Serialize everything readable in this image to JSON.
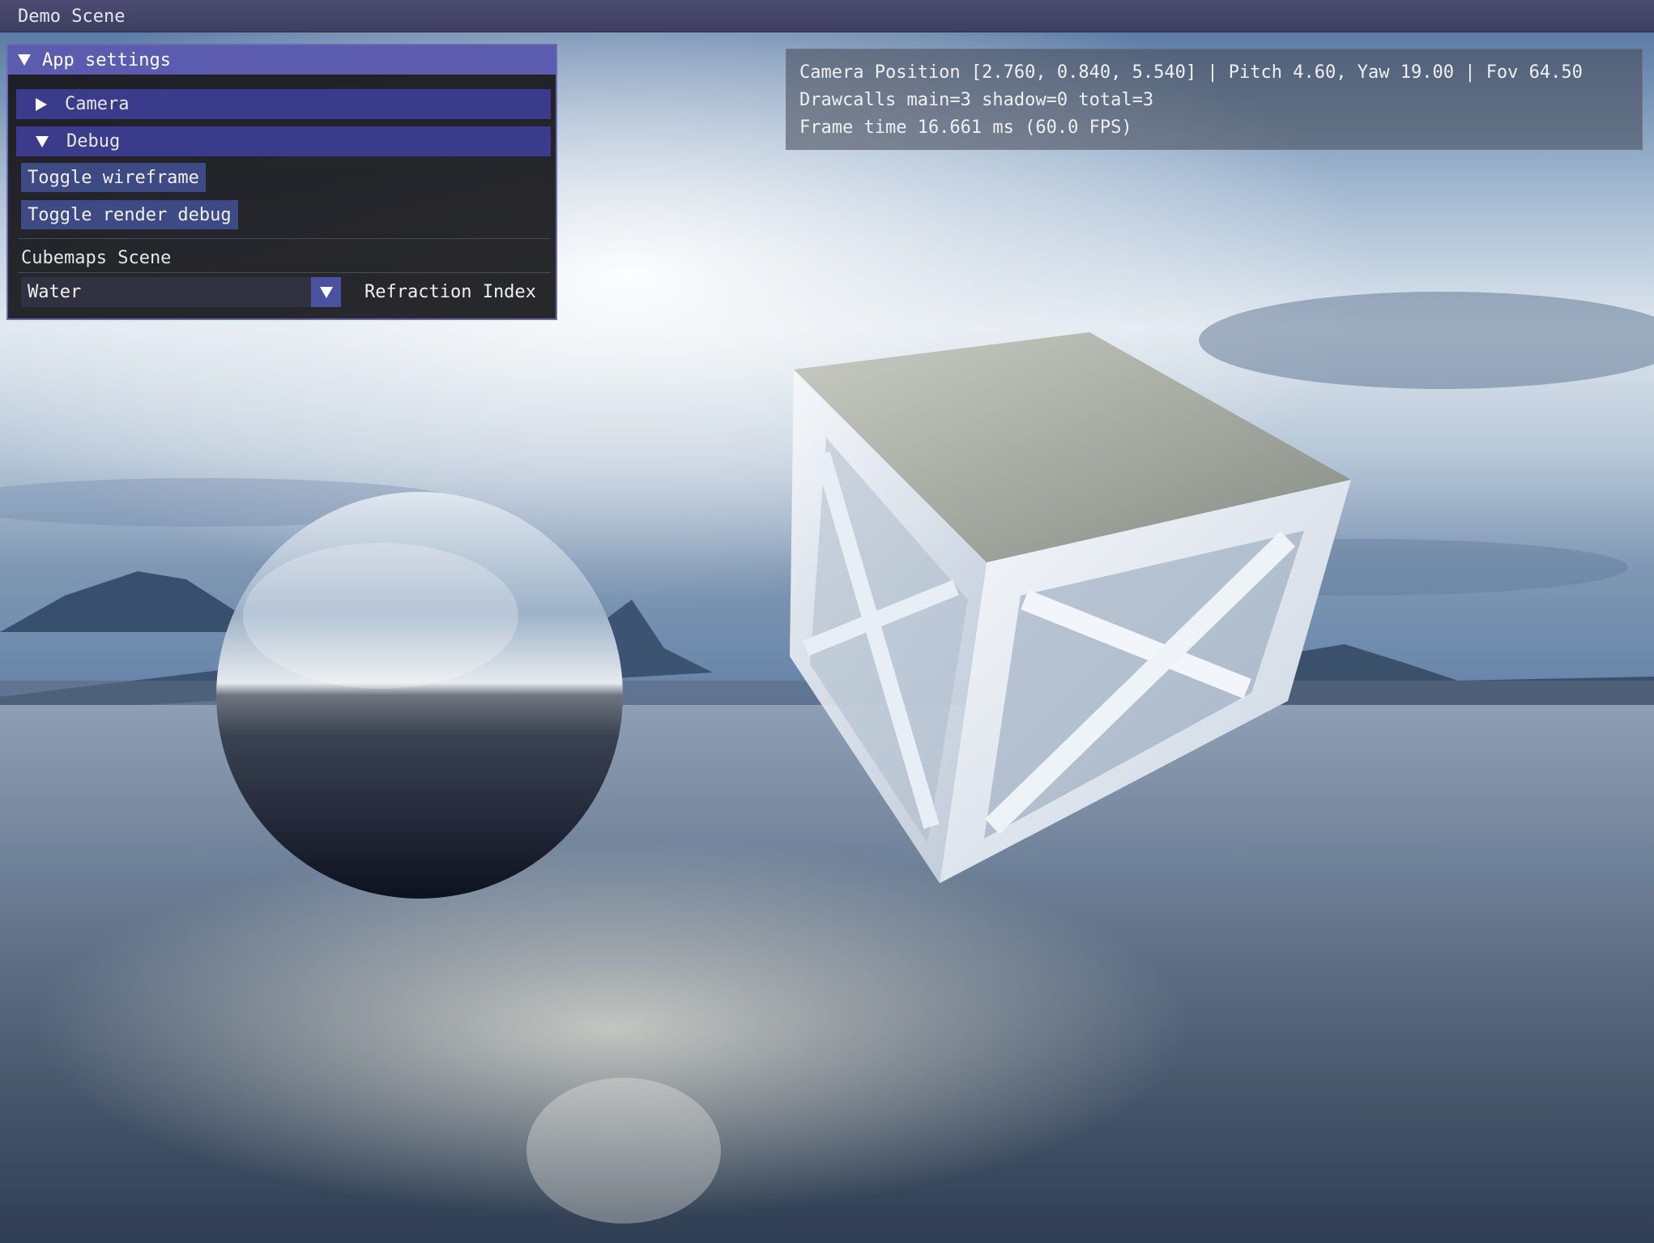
{
  "window": {
    "title": "Demo Scene"
  },
  "settings_panel": {
    "title": "App settings",
    "sections": [
      {
        "label": "Camera",
        "expanded": false
      },
      {
        "label": "Debug",
        "expanded": true
      }
    ],
    "buttons": {
      "wireframe": "Toggle wireframe",
      "render_debug": "Toggle render debug"
    },
    "scene_label": "Cubemaps Scene",
    "refraction": {
      "selected": "Water",
      "label": "Refraction Index"
    }
  },
  "stats": {
    "camera_line": "Camera Position [2.760, 0.840, 5.540] | Pitch 4.60, Yaw 19.00 | Fov 64.50",
    "drawcalls_line": "Drawcalls main=3 shadow=0 total=3",
    "frame_line": "Frame time 16.661 ms (60.0 FPS)"
  },
  "scene": {
    "objects": [
      "reflective-sphere",
      "glass-cube-frame"
    ],
    "colors": {
      "panel_header": "#5b5bb0",
      "section_header": "#3b3b8c",
      "button": "#3d4a83",
      "titlebar": "#4b4b72"
    }
  }
}
